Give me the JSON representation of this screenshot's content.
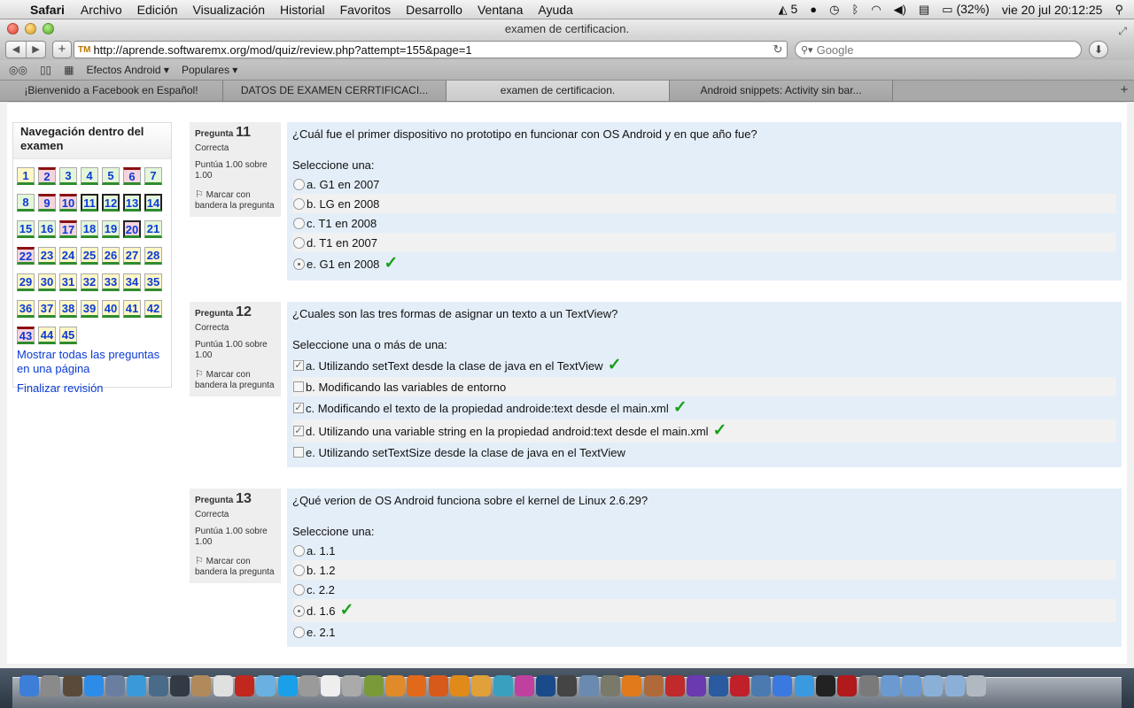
{
  "menubar": {
    "app": "Safari",
    "items": [
      "Archivo",
      "Edición",
      "Visualización",
      "Historial",
      "Favoritos",
      "Desarrollo",
      "Ventana",
      "Ayuda"
    ],
    "adobe_count": "5",
    "battery": "(32%)",
    "clock": "vie 20 jul  20:12:25"
  },
  "window": {
    "title": "examen de certificacion.",
    "url": "http://aprende.softwaremx.org/mod/quiz/review.php?attempt=155&page=1",
    "search_placeholder": "Google",
    "bookmarks": [
      "Efectos Android ▾",
      "Populares ▾"
    ],
    "tabs": [
      {
        "label": "¡Bienvenido a Facebook en Español!",
        "active": false
      },
      {
        "label": "DATOS DE EXAMEN CERRTIFICACI...",
        "active": false
      },
      {
        "label": "examen de certificacion.",
        "active": true
      },
      {
        "label": "Android snippets: Activity sin bar...",
        "active": false
      }
    ]
  },
  "quiz_nav": {
    "title": "Navegación dentro del examen",
    "buttons": [
      {
        "n": "1",
        "state": "partial"
      },
      {
        "n": "2",
        "state": "incorrect-flag"
      },
      {
        "n": "3",
        "state": "correct"
      },
      {
        "n": "4",
        "state": "correct"
      },
      {
        "n": "5",
        "state": "correct"
      },
      {
        "n": "6",
        "state": "incorrect-flag"
      },
      {
        "n": "7",
        "state": "correct"
      },
      {
        "n": "8",
        "state": "correct"
      },
      {
        "n": "9",
        "state": "incorrect-flag"
      },
      {
        "n": "10",
        "state": "incorrect-flag"
      },
      {
        "n": "11",
        "state": "current"
      },
      {
        "n": "12",
        "state": "current"
      },
      {
        "n": "13",
        "state": "current"
      },
      {
        "n": "14",
        "state": "current"
      },
      {
        "n": "15",
        "state": "correct"
      },
      {
        "n": "16",
        "state": "correct"
      },
      {
        "n": "17",
        "state": "incorrect-flag"
      },
      {
        "n": "18",
        "state": "correct"
      },
      {
        "n": "19",
        "state": "correct"
      },
      {
        "n": "20",
        "state": "incorrect-current"
      },
      {
        "n": "21",
        "state": "correct"
      },
      {
        "n": "22",
        "state": "incorrect-flag"
      },
      {
        "n": "23",
        "state": "partial"
      },
      {
        "n": "24",
        "state": "partial"
      },
      {
        "n": "25",
        "state": "partial"
      },
      {
        "n": "26",
        "state": "partial"
      },
      {
        "n": "27",
        "state": "partial"
      },
      {
        "n": "28",
        "state": "partial"
      },
      {
        "n": "29",
        "state": "partial"
      },
      {
        "n": "30",
        "state": "partial"
      },
      {
        "n": "31",
        "state": "partial"
      },
      {
        "n": "32",
        "state": "partial"
      },
      {
        "n": "33",
        "state": "partial"
      },
      {
        "n": "34",
        "state": "partial"
      },
      {
        "n": "35",
        "state": "partial"
      },
      {
        "n": "36",
        "state": "partial"
      },
      {
        "n": "37",
        "state": "partial"
      },
      {
        "n": "38",
        "state": "partial"
      },
      {
        "n": "39",
        "state": "partial"
      },
      {
        "n": "40",
        "state": "partial"
      },
      {
        "n": "41",
        "state": "partial"
      },
      {
        "n": "42",
        "state": "partial"
      },
      {
        "n": "43",
        "state": "incorrect-flag"
      },
      {
        "n": "44",
        "state": "partial"
      },
      {
        "n": "45",
        "state": "partial"
      }
    ],
    "show_all": "Mostrar todas las preguntas en una página",
    "finish": "Finalizar revisión"
  },
  "questions": [
    {
      "label": "Pregunta",
      "number": "11",
      "state": "Correcta",
      "grade": "Puntúa 1.00 sobre 1.00",
      "flag_text": "Marcar con bandera la pregunta",
      "text": "¿Cuál fue el primer dispositivo no prototipo en funcionar con OS Android y en que año fue?",
      "prompt": "Seleccione una:",
      "type": "radio",
      "answers": [
        {
          "text": "a. G1 en 2007",
          "selected": false,
          "correct": false
        },
        {
          "text": "b. LG en 2008",
          "selected": false,
          "correct": false
        },
        {
          "text": "c. T1 en 2008",
          "selected": false,
          "correct": false
        },
        {
          "text": "d. T1 en 2007",
          "selected": false,
          "correct": false
        },
        {
          "text": "e. G1 en 2008",
          "selected": true,
          "correct": true
        }
      ]
    },
    {
      "label": "Pregunta",
      "number": "12",
      "state": "Correcta",
      "grade": "Puntúa 1.00 sobre 1.00",
      "flag_text": "Marcar con bandera la pregunta",
      "text": "¿Cuales son las tres formas de asignar un texto a un TextView?",
      "prompt": "Seleccione una o más de una:",
      "type": "checkbox",
      "answers": [
        {
          "text": "a. Utilizando setText desde la clase de java en el TextView",
          "selected": true,
          "correct": true
        },
        {
          "text": "b. Modificando las variables de entorno",
          "selected": false,
          "correct": false
        },
        {
          "text": "c. Modificando el texto de la propiedad androide:text desde el main.xml",
          "selected": true,
          "correct": true
        },
        {
          "text": "d. Utilizando una variable string en la propiedad android:text desde el main.xml",
          "selected": true,
          "correct": true
        },
        {
          "text": "e. Utilizando setTextSize desde la clase de java en el TextView",
          "selected": false,
          "correct": false
        }
      ]
    },
    {
      "label": "Pregunta",
      "number": "13",
      "state": "Correcta",
      "grade": "Puntúa 1.00 sobre 1.00",
      "flag_text": "Marcar con bandera la pregunta",
      "text": "¿Qué verion de OS Android funciona sobre el kernel de Linux 2.6.29?",
      "prompt": "Seleccione una:",
      "type": "radio",
      "answers": [
        {
          "text": "a. 1.1",
          "selected": false,
          "correct": false
        },
        {
          "text": "b. 1.2",
          "selected": false,
          "correct": false
        },
        {
          "text": "c. 2.2",
          "selected": false,
          "correct": false
        },
        {
          "text": "d. 1.6",
          "selected": true,
          "correct": true
        },
        {
          "text": "e. 2.1",
          "selected": false,
          "correct": false
        }
      ]
    }
  ],
  "dock": {
    "icons": [
      {
        "name": "finder-icon",
        "color": "#3d7ed8"
      },
      {
        "name": "launchpad-icon",
        "color": "#8a8a8a"
      },
      {
        "name": "mission-control-icon",
        "color": "#5a4a3a"
      },
      {
        "name": "app-store-icon",
        "color": "#2d8ce8"
      },
      {
        "name": "preview-icon",
        "color": "#6a7ea0"
      },
      {
        "name": "safari-icon",
        "color": "#3a9ad9"
      },
      {
        "name": "screen-capture-icon",
        "color": "#4a6a8a"
      },
      {
        "name": "x11-icon",
        "color": "#333a44"
      },
      {
        "name": "contacts-icon",
        "color": "#b08a5a"
      },
      {
        "name": "calendar-icon",
        "color": "#e0e0e0"
      },
      {
        "name": "filezilla-icon",
        "color": "#c0281e"
      },
      {
        "name": "virtualbox-icon",
        "color": "#6ab0e0"
      },
      {
        "name": "skype-icon",
        "color": "#1aa0e8"
      },
      {
        "name": "network-icon",
        "color": "#9a9a9a"
      },
      {
        "name": "textedit-icon",
        "color": "#eeeeee"
      },
      {
        "name": "printer-icon",
        "color": "#aaaaaa"
      },
      {
        "name": "android-icon",
        "color": "#7a9a3a"
      },
      {
        "name": "blender-icon",
        "color": "#e08a2a"
      },
      {
        "name": "firefox-icon",
        "color": "#e06a1a"
      },
      {
        "name": "firefox-alt-icon",
        "color": "#d85a1a"
      },
      {
        "name": "illustrator-icon",
        "color": "#e08a1a"
      },
      {
        "name": "sketchup-icon",
        "color": "#e0a03a"
      },
      {
        "name": "globe-app-icon",
        "color": "#3aa0c0"
      },
      {
        "name": "flower-app-icon",
        "color": "#c040a0"
      },
      {
        "name": "photoshop-icon",
        "color": "#1a4a8a"
      },
      {
        "name": "unity-icon",
        "color": "#444444"
      },
      {
        "name": "cube-app-icon",
        "color": "#6a8ab0"
      },
      {
        "name": "tools-icon",
        "color": "#7a7a6a"
      },
      {
        "name": "vlc-icon",
        "color": "#e07a1a"
      },
      {
        "name": "game-app-icon",
        "color": "#b06a3a"
      },
      {
        "name": "angry-birds-icon",
        "color": "#c02a2a"
      },
      {
        "name": "magic-app-icon",
        "color": "#6a3ab0"
      },
      {
        "name": "network-utility-icon",
        "color": "#2a5aa0"
      },
      {
        "name": "red-app-icon",
        "color": "#c0202a"
      },
      {
        "name": "chart-app-icon",
        "color": "#4a7ab0"
      },
      {
        "name": "itunes-icon",
        "color": "#3a7ae0"
      },
      {
        "name": "twitter-icon",
        "color": "#3a9ae0"
      },
      {
        "name": "terminal-icon",
        "color": "#222222"
      },
      {
        "name": "red-book-icon",
        "color": "#b01a1a"
      },
      {
        "name": "system-prefs-icon",
        "color": "#7a7a7a"
      },
      {
        "name": "stack-folder-icon",
        "color": "#6a9ad0"
      },
      {
        "name": "downloads-folder-icon",
        "color": "#6a9ad0"
      },
      {
        "name": "documents-folder-icon",
        "color": "#8ab0d8"
      },
      {
        "name": "app-folder-icon",
        "color": "#8ab0d8"
      },
      {
        "name": "trash-icon",
        "color": "#b0b8c0"
      }
    ]
  }
}
